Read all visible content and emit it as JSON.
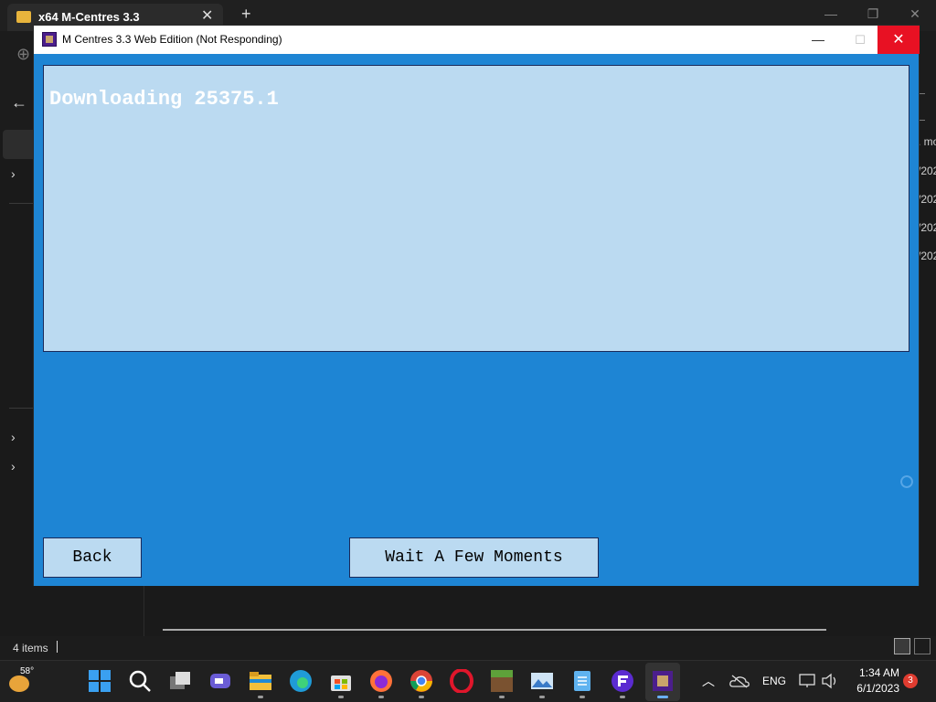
{
  "explorer": {
    "tab_title": "x64 M-Centres 3.3",
    "status_items": "4 items",
    "right_column": [
      ". mo",
      "/202",
      "/202",
      "/202",
      "/202"
    ]
  },
  "dialog": {
    "title": "M Centres 3.3 Web Edition (Not Responding)",
    "panel_text": "Downloading 25375.1",
    "back_label": "Back",
    "wait_label": "Wait A Few Moments",
    "accent_color": "#1e85d4",
    "panel_color": "#bbdaf1"
  },
  "taskbar": {
    "weather_temp": "58°",
    "apps": [
      "start-icon",
      "search-icon",
      "task-view-icon",
      "teams-icon",
      "file-explorer-icon",
      "edge-icon",
      "store-icon",
      "firefox-icon",
      "chrome-icon",
      "opera-icon",
      "minecraft-icon",
      "photos-icon",
      "notepad-icon",
      "app-f-icon",
      "m-centres-icon"
    ],
    "language": "ENG",
    "time": "1:34 AM",
    "date": "6/1/2023",
    "notifications": "3"
  }
}
